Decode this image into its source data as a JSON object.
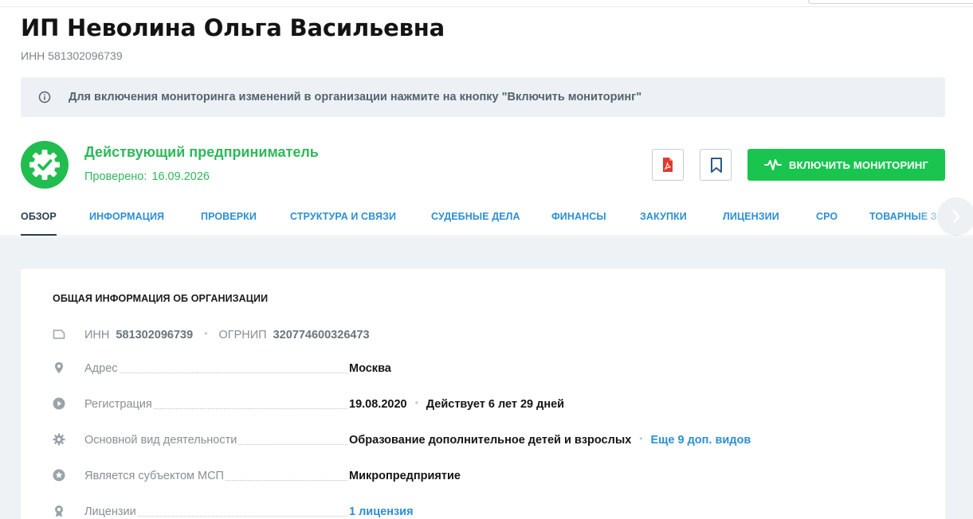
{
  "header": {
    "title": "ИП Неволина Ольга Васильевна",
    "inn_subtitle": "ИНН 581302096739"
  },
  "notice": {
    "text": "Для включения мониторинга изменений в организации нажмите на кнопку \"Включить мониторинг\""
  },
  "status": {
    "title": "Действующий предприниматель",
    "checked_label": "Проверено:",
    "checked_date": "16.09.2026"
  },
  "actions": {
    "monitor_label": "ВКЛЮЧИТЬ МОНИТОРИНГ"
  },
  "tabs": [
    {
      "label": "ОБЗОР"
    },
    {
      "label": "ИНФОРМАЦИЯ"
    },
    {
      "label": "ПРОВЕРКИ"
    },
    {
      "label": "СТРУКТУРА И СВЯЗИ"
    },
    {
      "label": "СУДЕБНЫЕ ДЕЛА"
    },
    {
      "label": "ФИНАНСЫ"
    },
    {
      "label": "ЗАКУПКИ"
    },
    {
      "label": "ЛИЦЕНЗИИ"
    },
    {
      "label": "СРО"
    },
    {
      "label": "ТОВАРНЫЕ ЗНАКИ"
    }
  ],
  "card": {
    "title": "ОБЩАЯ ИНФОРМАЦИЯ ОБ ОРГАНИЗАЦИИ",
    "inn_label": "ИНН",
    "inn_value": "581302096739",
    "ogrnip_label": "ОГРНИП",
    "ogrnip_value": "320774600326473",
    "rows": {
      "address": {
        "label": "Адрес",
        "value": "Москва"
      },
      "registration": {
        "label": "Регистрация",
        "date": "19.08.2020",
        "duration": "Действует 6 лет 29 дней"
      },
      "activity": {
        "label": "Основной вид деятельности",
        "value": "Образование дополнительное детей и взрослых",
        "more": "Еще 9 доп. видов"
      },
      "msp": {
        "label": "Является субъектом МСП",
        "value": "Микропредприятие"
      },
      "licenses": {
        "label": "Лицензии",
        "value": "1 лицензия"
      }
    }
  },
  "colors": {
    "green": "#19c54f",
    "link_blue": "#2c8fd4",
    "active_tab": "#2b3f4e"
  }
}
